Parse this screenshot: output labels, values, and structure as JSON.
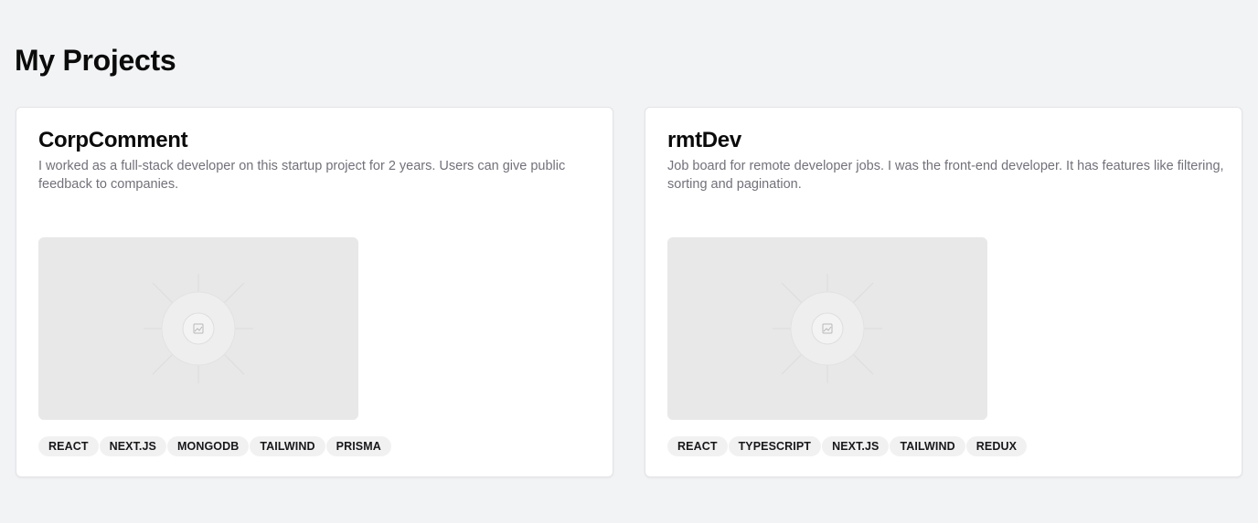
{
  "page": {
    "title": "My Projects"
  },
  "projects": [
    {
      "title": "CorpComment",
      "description": "I worked as a full-stack developer on this startup project for 2 years. Users can give public feedback to companies.",
      "image_icon": "image-placeholder-icon",
      "tags": [
        "REACT",
        "NEXT.JS",
        "MONGODB",
        "TAILWIND",
        "PRISMA"
      ]
    },
    {
      "title": "rmtDev",
      "description": "Job board for remote developer jobs. I was the front-end developer. It has features like filtering, sorting and pagination.",
      "image_icon": "image-placeholder-icon",
      "tags": [
        "REACT",
        "TYPESCRIPT",
        "NEXT.JS",
        "TAILWIND",
        "REDUX"
      ]
    }
  ],
  "colors": {
    "background": "#f2f3f5",
    "card": "#ffffff",
    "muted_text": "#71717a",
    "tag_bg": "#f1f1f2",
    "placeholder_bg": "#e8e8e8"
  }
}
